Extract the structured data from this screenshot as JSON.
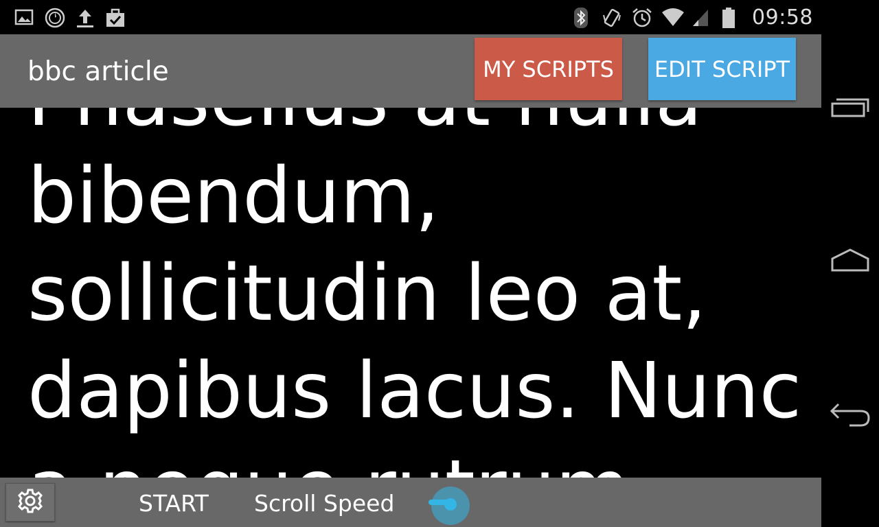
{
  "status_bar": {
    "left_icons": [
      "image-icon",
      "sync-icon",
      "upload-icon",
      "briefcase-check-icon"
    ],
    "right_icons": [
      "bluetooth-icon",
      "vibrate-icon",
      "alarm-icon",
      "wifi-icon",
      "signal-icon",
      "battery-icon"
    ],
    "time": "09:58"
  },
  "action_bar": {
    "title": "bbc article",
    "my_scripts_label": "MY SCRIPTS",
    "edit_script_label": "EDIT SCRIPT",
    "my_scripts_color": "#cc5a48",
    "edit_script_color": "#4aa9e3"
  },
  "reader": {
    "text": "Phasellus at nulla\nbibendum,\nsollicitudin leo at,\ndapibus lacus. Nunc\na neque rutrum"
  },
  "controls": {
    "start_label": "START",
    "scroll_speed_label": "Scroll Speed",
    "scroll_speed_value": 0.05,
    "accent_color": "#33b5e5"
  },
  "nav_bar": {
    "buttons": [
      "recent-apps-icon",
      "home-icon",
      "back-icon"
    ]
  }
}
